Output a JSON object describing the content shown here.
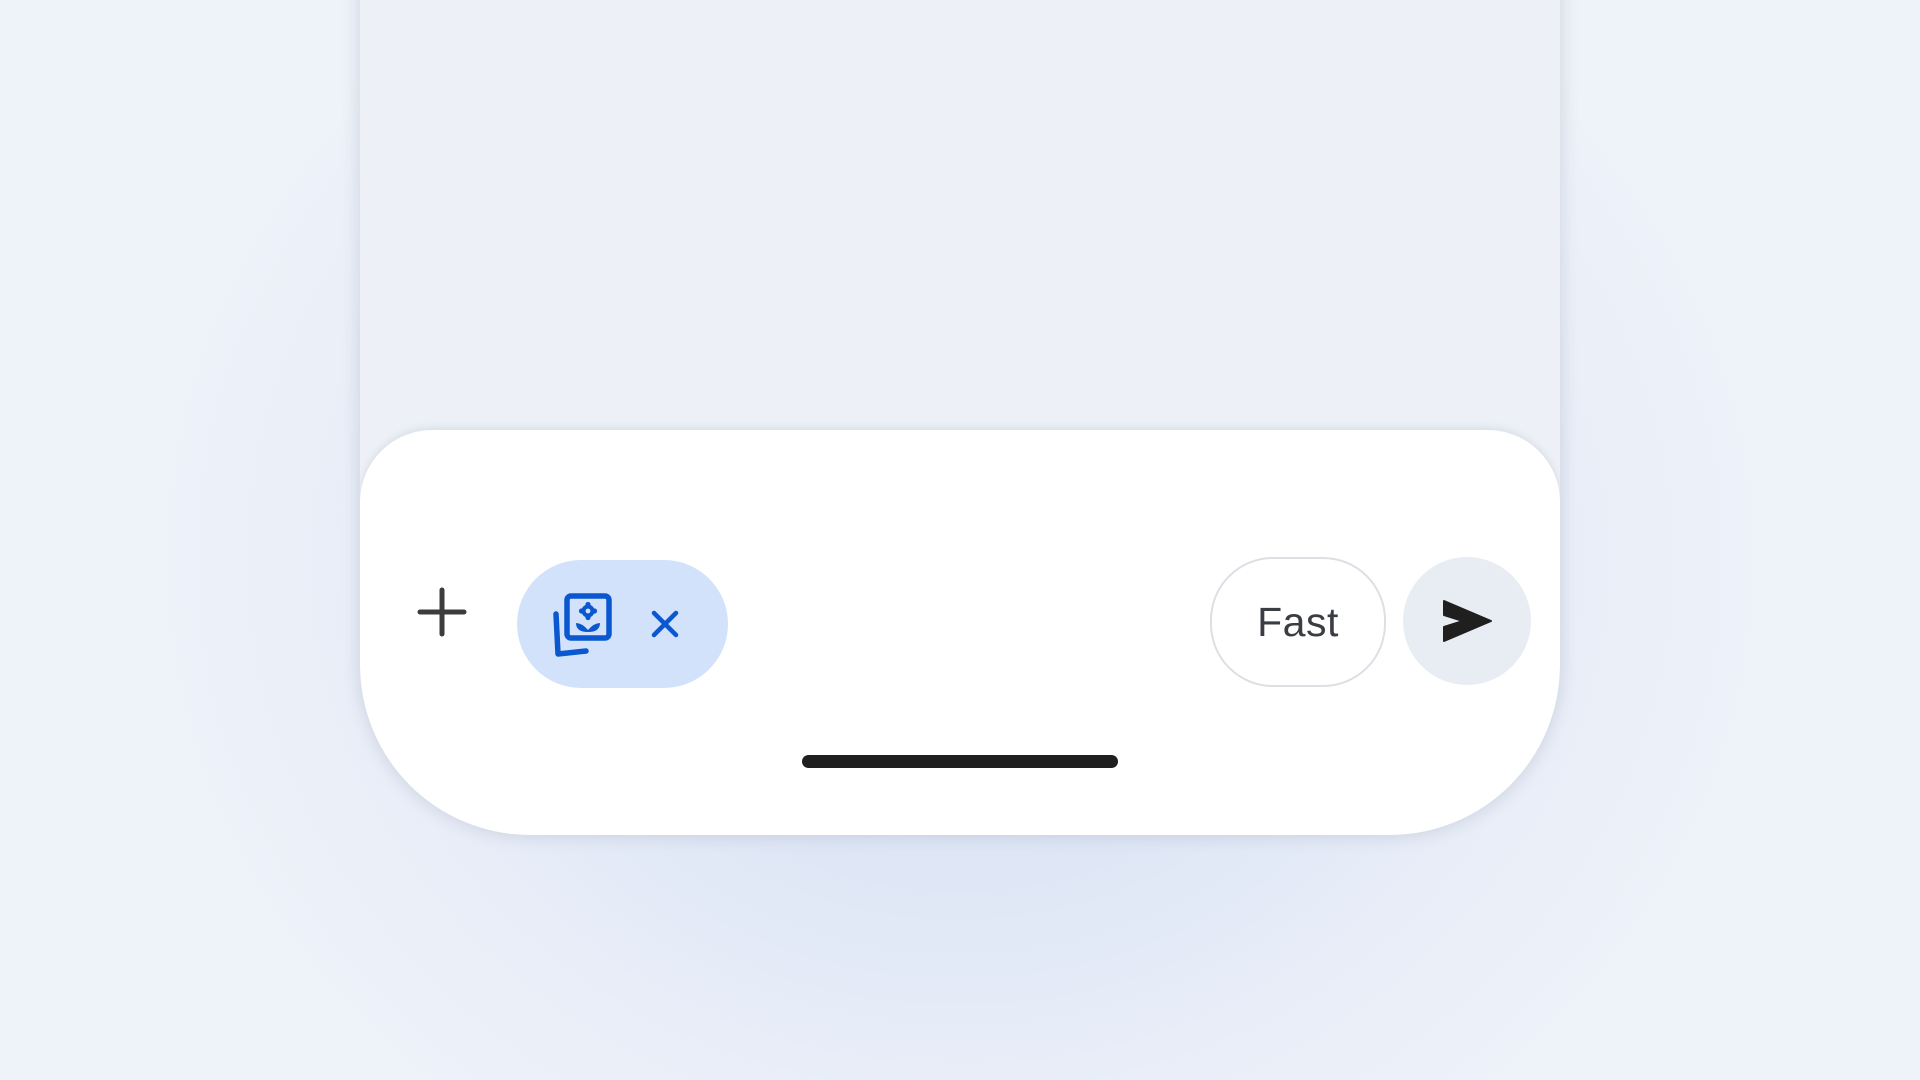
{
  "composer": {
    "add_icon": "plus-icon",
    "attachment": {
      "icon": "image-gallery-icon",
      "remove_icon": "close-icon"
    },
    "model_selector": {
      "label": "Fast"
    },
    "send_icon": "send-icon"
  },
  "colors": {
    "background": "#e3eaf6",
    "composer": "#ffffff",
    "chip_background": "#d3e2fb",
    "chip_accent": "#0b57d0",
    "send_background": "#e8edf4",
    "icon_dark": "#3c3c3c"
  }
}
